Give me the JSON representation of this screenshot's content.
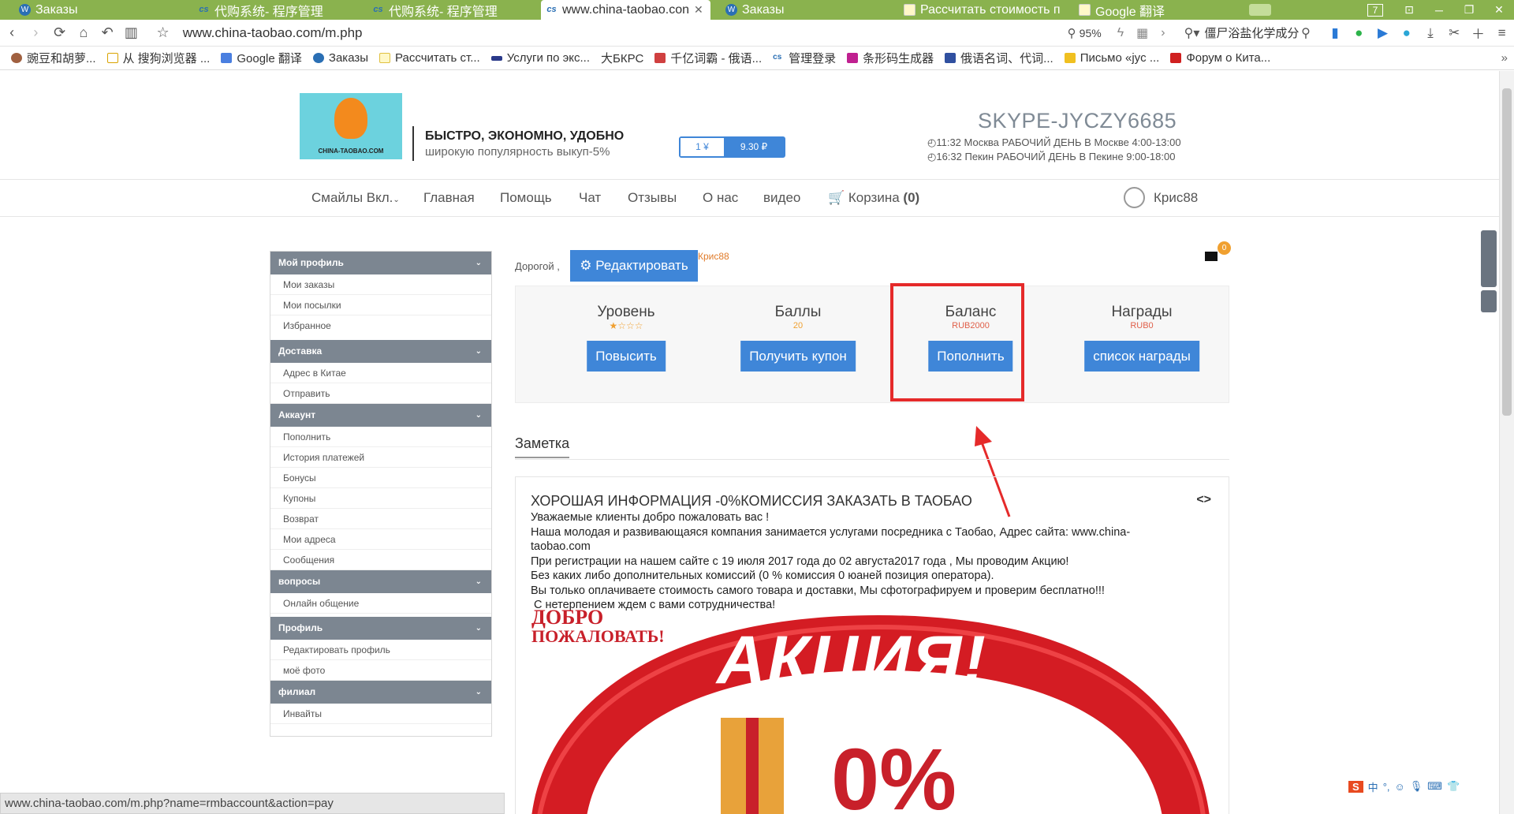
{
  "browser": {
    "tabs": [
      {
        "label": "Заказы",
        "icon": "wp-icon"
      },
      {
        "label": "代购系统- 程序管理",
        "icon": "cs-icon"
      },
      {
        "label": "代购系统- 程序管理",
        "icon": "cs-icon"
      },
      {
        "label": "www.china-taobao.con",
        "icon": "cs-icon"
      },
      {
        "label": "Заказы",
        "icon": "wp-icon"
      },
      {
        "label": "Рассчитать стоимость п",
        "icon": "doc-icon"
      },
      {
        "label": "Google 翻译",
        "icon": "doc-icon"
      }
    ],
    "tab_count": "7",
    "url": "www.china-taobao.com/m.php",
    "zoom": "95%",
    "search_text": "僵尸浴盐化学成分",
    "bookmarks": [
      "豌豆和胡萝...",
      "从 搜狗浏览器 ...",
      "Google 翻译",
      "Заказы",
      "Рассчитать ст...",
      "Услуги по экс...",
      "大БКРС",
      "千亿词霸 - 俄语...",
      "管理登录",
      "条形码生成器",
      "俄语名词、代词...",
      "Письмо «jyc ...",
      "Форум о Кита..."
    ],
    "status_url": "www.china-taobao.com/m.php?name=rmbaccount&action=pay"
  },
  "header": {
    "logo_text": "CHINA-TAOBAO.COM",
    "slogan_1": "БЫСТРО, ЭКОНОМНО, УДОБНО",
    "slogan_2": "широкую популярность выкуп-5%",
    "rate_left": "1 ¥",
    "rate_right": "9.30 ₽",
    "skype": "SKYPE-JYCZY6685",
    "time_moscow": "◴11:32  Москва   РАБОЧИЙ ДЕНЬ В Москве 4:00-13:00",
    "time_beijing": "◴16:32  Пекин    РАБОЧИЙ ДЕНЬ В Пекине 9:00-18:00"
  },
  "nav": {
    "items": [
      "Смайлы Вкл.",
      "Главная",
      "Помощь",
      "Чат",
      "Отзывы",
      "О нас",
      "видео"
    ],
    "cart_label": "Корзина",
    "cart_count": "(0)",
    "username": "Крис88"
  },
  "sidebar": {
    "sections": [
      {
        "title": "Мой профиль",
        "items": [
          "Мои заказы",
          "Мои посылки",
          "Избранное"
        ]
      },
      {
        "title": "Доставка",
        "items": [
          "Адрес в Китае",
          "Отправить"
        ]
      },
      {
        "title": "Аккаунт",
        "items": [
          "Пополнить",
          "История платежей",
          "Бонусы",
          "Купоны",
          "Возврат",
          "Мои адреса",
          "Сообщения"
        ]
      },
      {
        "title": "вопросы",
        "items": [
          "Онлайн общение"
        ]
      },
      {
        "title": "Профиль",
        "items": [
          "Редактировать профиль",
          "моё фото"
        ]
      },
      {
        "title": "филиал",
        "items": [
          "Инвайты"
        ]
      }
    ]
  },
  "main": {
    "dear": "Дорогой ,",
    "edit_button": "Редактировать",
    "username": "Крис88",
    "mail_count": "0",
    "stats": [
      {
        "title": "Уровень",
        "value": "★☆☆☆",
        "button": "Повысить"
      },
      {
        "title": "Баллы",
        "value": "20",
        "button": "Получить купон"
      },
      {
        "title": "Баланс",
        "value": "RUB2000",
        "button": "Пополнить"
      },
      {
        "title": "Награды",
        "value": "RUB0",
        "button": "список награды"
      }
    ],
    "note_tab": "Заметка",
    "note_title": "ХОРОШАЯ ИНФОРМАЦИЯ -0%КОМИССИЯ   ЗАКАЗАТЬ В ТАОБАО",
    "note_code_icon": "<>",
    "note_lines": [
      "Уважаемые клиенты добро пожаловать вас !",
      "Наша молодая и развивающаяся компания занимается услугами посредника с Таобао, Адрес сайта: www.china-taobao.com",
      "При регистрации на нашем сайте с 19 июля 2017 года до 02 августа2017 года , Мы проводим Акцию!",
      "Без каких либо дополнительных комиссий (0 % комиссия 0 юаней позиция оператора).",
      "Вы только оплачиваете стоимость самого товара и доставки, Мы сфотографируем и проверим бесплатно!!!",
      " С нетерпением ждем с вами сотрудничества!"
    ],
    "banner_welcome_1": "ДОБРО",
    "banner_welcome_2": "ПОЖАЛОВАТЬ!",
    "banner_text": "АКЦИЯ!",
    "banner_percent": "0%"
  },
  "colors": {
    "accent": "#3f86d8",
    "tabbar": "#8ab24e",
    "highlight": "#e52a2a",
    "sidebar_header": "#7c8691"
  }
}
